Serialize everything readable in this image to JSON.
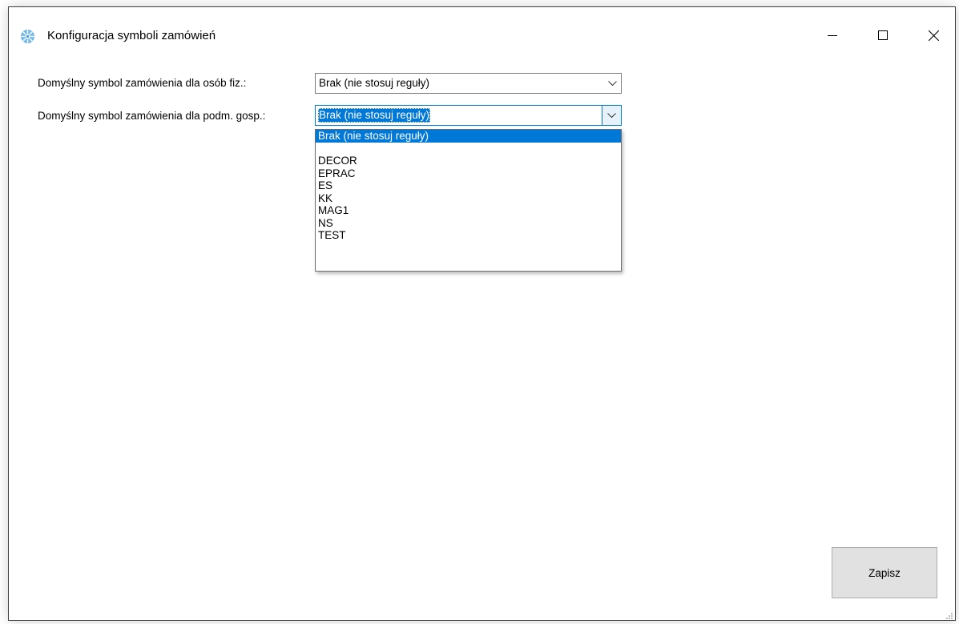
{
  "window": {
    "title": "Konfiguracja symboli zamówień",
    "icon": "gear-icon",
    "controls": [
      "minimize-icon",
      "maximize-icon",
      "close-icon"
    ]
  },
  "form": {
    "label_individuals": "Domyślny symbol zamówienia dla osób fiz.:",
    "label_businesses": "Domyślny symbol zamówienia dla podm. gosp.:",
    "select_individuals_value": "Brak (nie stosuj reguły)",
    "select_businesses_value": "Brak (nie stosuj reguły)"
  },
  "dropdown": {
    "options": [
      "Brak (nie stosuj reguły)",
      "",
      "DECOR",
      "EPRAC",
      "ES",
      "KK",
      "MAG1",
      "NS",
      "TEST"
    ],
    "selected_index": 0
  },
  "buttons": {
    "save_label": "Zapisz"
  },
  "colors": {
    "accent": "#0078d7",
    "button_bg": "#e1e1e1"
  }
}
